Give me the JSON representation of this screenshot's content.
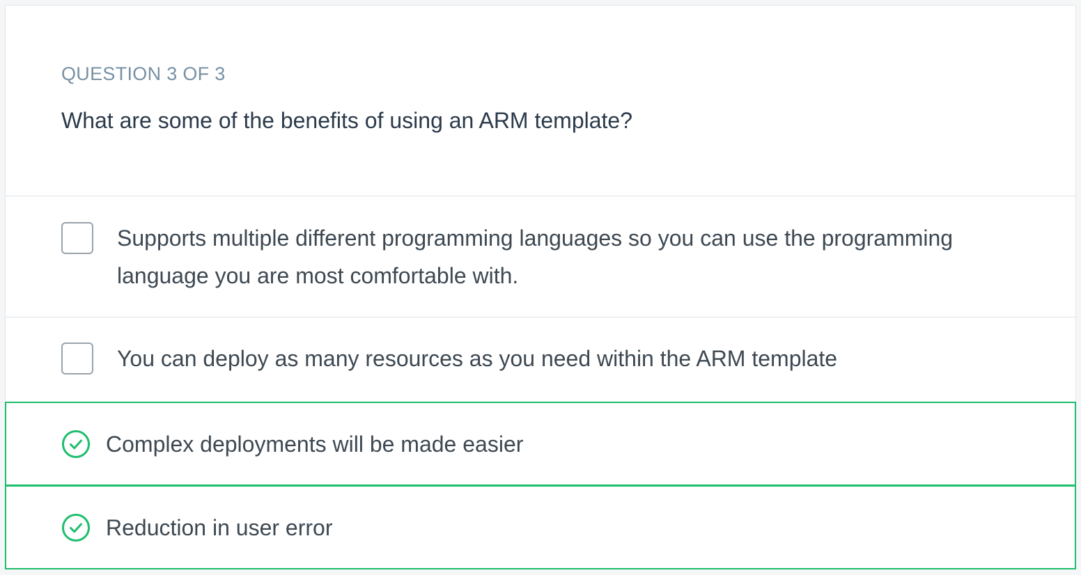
{
  "question": {
    "counter": "QUESTION 3 OF 3",
    "text": "What are some of the benefits of using an ARM template?"
  },
  "options": [
    {
      "label": "Supports multiple different programming languages so you can use the programming language you are most comfortable with.",
      "state": "unchecked"
    },
    {
      "label": "You can deploy as many resources as you need within the ARM template",
      "state": "unchecked"
    },
    {
      "label": "Complex deployments will be made easier",
      "state": "correct",
      "icon": "check-circle-icon"
    },
    {
      "label": "Reduction in user error",
      "state": "correct",
      "icon": "check-circle-icon"
    }
  ],
  "colors": {
    "correct": "#1dbe6c",
    "counter": "#7790a3",
    "question_text": "#2b3a4a",
    "option_text": "#3d4852",
    "checkbox_border": "#98a3ac"
  }
}
